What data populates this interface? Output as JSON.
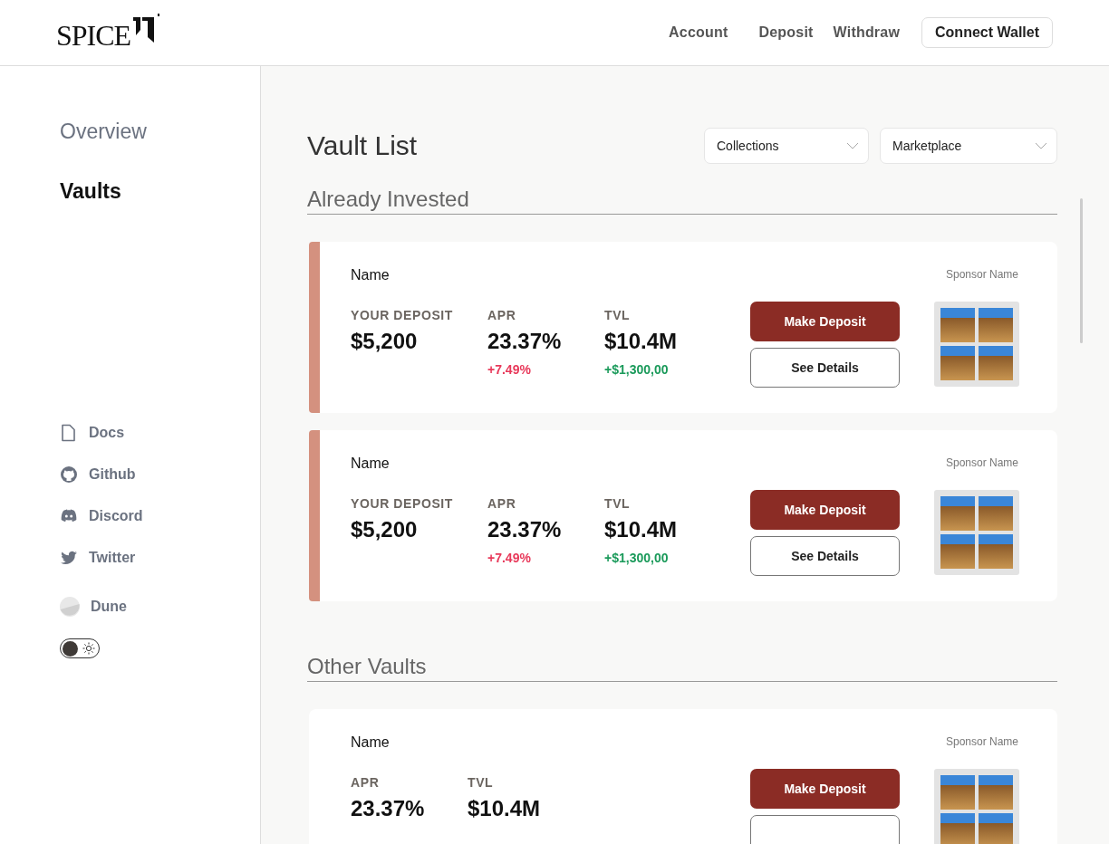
{
  "header": {
    "logo": "SPICE",
    "nav": [
      {
        "label": "Account",
        "selected": false
      },
      {
        "label": "Deposit",
        "selected": false
      },
      {
        "label": "Withdraw",
        "selected": false
      }
    ],
    "connect_button": "Connect Wallet"
  },
  "sidebar": {
    "items": [
      {
        "label": "Overview",
        "selected": false
      },
      {
        "label": "Vaults",
        "selected": true
      }
    ],
    "links": [
      {
        "label": "Docs",
        "kind": "docs"
      },
      {
        "label": "Github",
        "kind": "github"
      },
      {
        "label": "Discord",
        "kind": "discord"
      },
      {
        "label": "Twitter",
        "kind": "twitter"
      },
      {
        "label": "Dune",
        "kind": "dune"
      }
    ],
    "theme_toggle": {
      "on": false
    }
  },
  "main": {
    "title": "Vault List",
    "filters": [
      {
        "label": "Collections"
      },
      {
        "label": "Marketplace"
      }
    ],
    "sections": [
      {
        "title": "Already Invested",
        "cards": [
          {
            "name": "Name",
            "sponsor": "Sponsor Name",
            "invested": true,
            "metrics": [
              {
                "label": "YOUR DEPOSIT",
                "value": "$5,200"
              },
              {
                "label": "APR",
                "value": "23.37%",
                "change": "+7.49%",
                "color": "#e8395a"
              },
              {
                "label": "TVL",
                "value": "$10.4M",
                "change": "+$1,300,00",
                "color": "#1a9a5a"
              }
            ],
            "primary_button": "Make Deposit",
            "secondary_button": "See Details"
          },
          {
            "name": "Name",
            "sponsor": "Sponsor Name",
            "invested": true,
            "metrics": [
              {
                "label": "YOUR DEPOSIT",
                "value": "$5,200"
              },
              {
                "label": "APR",
                "value": "23.37%",
                "change": "+7.49%",
                "color": "#e8395a"
              },
              {
                "label": "TVL",
                "value": "$10.4M",
                "change": "+$1,300,00",
                "color": "#1a9a5a"
              }
            ],
            "primary_button": "Make Deposit",
            "secondary_button": "See Details"
          }
        ]
      },
      {
        "title": "Other Vaults",
        "cards": [
          {
            "name": "Name",
            "sponsor": "Sponsor Name",
            "invested": false,
            "metrics": [
              {
                "label": "APR",
                "value": "23.37%"
              },
              {
                "label": "TVL",
                "value": "$10.4M"
              }
            ],
            "primary_button": "Make Deposit"
          }
        ]
      }
    ]
  }
}
